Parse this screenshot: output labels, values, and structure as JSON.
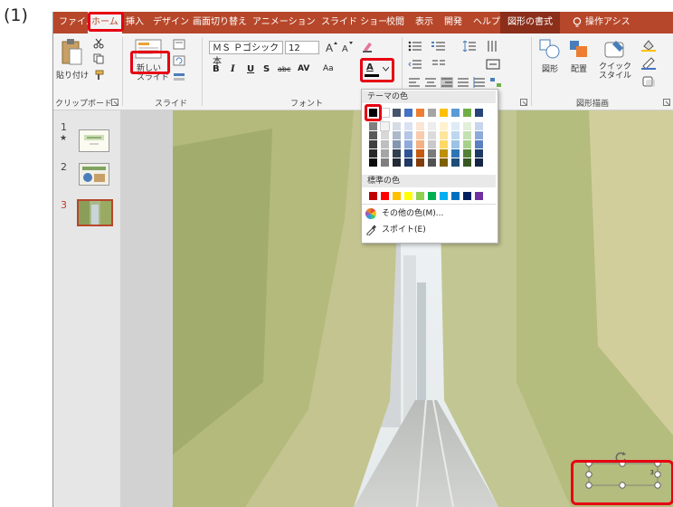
{
  "step_label": "(1)",
  "tabs": [
    "ファイル",
    "ホーム",
    "挿入",
    "デザイン",
    "画面切り替え",
    "アニメーション",
    "スライド ショー",
    "校閲",
    "表示",
    "開発",
    "ヘルプ",
    "図形の書式",
    "操作アシス"
  ],
  "ribbon": {
    "clipboard": {
      "paste_label": "貼り付け",
      "group_label": "クリップボード"
    },
    "slides": {
      "new_slide_label": "新しい\nスライド",
      "group_label": "スライド"
    },
    "font": {
      "font_name": "ＭＳ Ｐゴシック 本",
      "font_size": "12",
      "bold": "B",
      "italic": "I",
      "underline": "U",
      "shadow": "S",
      "strike": "abc",
      "spacing": "AV",
      "case": "Aa",
      "font_color_letter": "A",
      "group_label": "フォント"
    },
    "drawing": {
      "shape_label": "図形",
      "arrange_label": "配置",
      "quick_style_label": "クイック\nスタイル",
      "group_label": "図形描画"
    }
  },
  "thumbnails": [
    {
      "num": "1",
      "star": "★"
    },
    {
      "num": "2"
    },
    {
      "num": "3"
    }
  ],
  "color_menu": {
    "theme_header": "テーマの色",
    "standard_header": "標準の色",
    "more_colors": "その他の色(M)...",
    "eyedropper": "スポイト(E)",
    "theme_top": [
      "#000000",
      "#ffffff",
      "#44546a",
      "#4472c4",
      "#ed7d31",
      "#a5a5a5",
      "#ffc000",
      "#5b9bd5",
      "#70ad47",
      "#264478"
    ],
    "theme_tints": [
      [
        "#7f7f7f",
        "#f2f2f2",
        "#d6dce4",
        "#d9e2f3",
        "#fbe5d5",
        "#ededed",
        "#fff2cc",
        "#deebf6",
        "#e2efd9",
        "#c7d6ed"
      ],
      [
        "#595959",
        "#d8d8d8",
        "#adb9ca",
        "#b4c6e7",
        "#f7cbac",
        "#dbdbdb",
        "#fee599",
        "#bdd7ee",
        "#c5e0b3",
        "#8eaadb"
      ],
      [
        "#3f3f3f",
        "#bfbfbf",
        "#8496b0",
        "#8eaadb",
        "#f4b183",
        "#c9c9c9",
        "#ffd965",
        "#9cc3e5",
        "#a8d08d",
        "#5b7fc1"
      ],
      [
        "#262626",
        "#a5a5a5",
        "#323f4f",
        "#2f5496",
        "#c55a11",
        "#7b7b7b",
        "#bf8f00",
        "#2e75b5",
        "#538135",
        "#1f3864"
      ],
      [
        "#0c0c0c",
        "#7f7f7f",
        "#222a35",
        "#1f3864",
        "#833c0b",
        "#525252",
        "#7f6000",
        "#1e4e79",
        "#375623",
        "#152546"
      ]
    ],
    "standard": [
      "#c00000",
      "#ff0000",
      "#ffc000",
      "#ffff00",
      "#92d050",
      "#00b050",
      "#00b0f0",
      "#0070c0",
      "#002060",
      "#7030a0"
    ]
  },
  "textbox_text": "3"
}
